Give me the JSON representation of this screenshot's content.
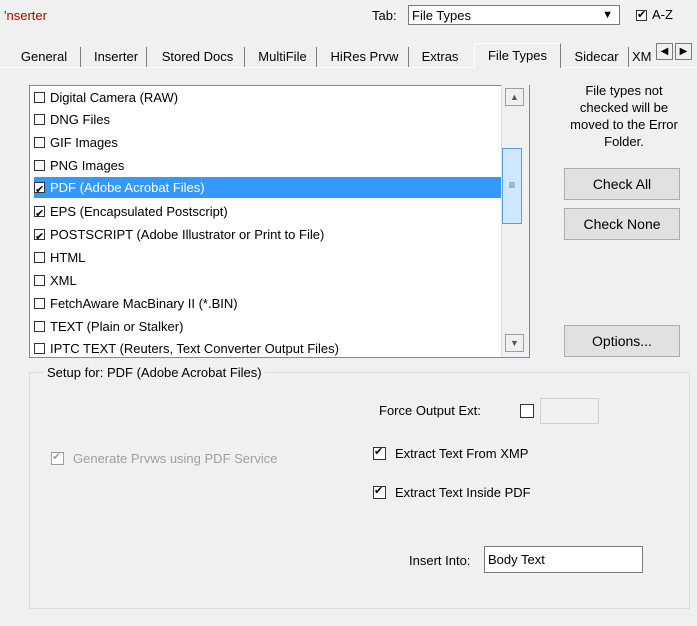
{
  "header": {
    "app_title": "'nserter",
    "tab_label": "Tab:",
    "tab_selected": "File Types",
    "az_label": "A-Z",
    "az_checked": true
  },
  "tabs": [
    {
      "label": "General"
    },
    {
      "label": "Inserter"
    },
    {
      "label": "Stored Docs"
    },
    {
      "label": "MultiFile"
    },
    {
      "label": "HiRes Prvw"
    },
    {
      "label": "Extras"
    },
    {
      "label": "File Types",
      "active": true
    },
    {
      "label": "Sidecar"
    },
    {
      "label": "XM"
    }
  ],
  "file_types": [
    {
      "label": "Digital Camera (RAW)",
      "checked": false
    },
    {
      "label": "DNG Files",
      "checked": false
    },
    {
      "label": "GIF Images",
      "checked": false
    },
    {
      "label": "PNG Images",
      "checked": false
    },
    {
      "label": "PDF (Adobe Acrobat Files)",
      "checked": true,
      "selected": true
    },
    {
      "label": "EPS (Encapsulated Postscript)",
      "checked": true
    },
    {
      "label": "POSTSCRIPT (Adobe Illustrator or Print to File)",
      "checked": true
    },
    {
      "label": "HTML",
      "checked": false
    },
    {
      "label": "XML",
      "checked": false
    },
    {
      "label": "FetchAware MacBinary II (*.BIN)",
      "checked": false
    },
    {
      "label": "TEXT (Plain or Stalker)",
      "checked": false
    },
    {
      "label": "IPTC TEXT (Reuters, Text Converter Output Files)",
      "checked": false
    }
  ],
  "side_note": "File types not checked will be moved to the Error Folder.",
  "buttons": {
    "check_all": "Check All",
    "check_none": "Check None",
    "options": "Options..."
  },
  "setup": {
    "legend": "Setup for:  PDF (Adobe Acrobat Files)",
    "force_output_label": "Force Output Ext:",
    "force_output_checked": false,
    "force_output_value": "",
    "generate_prvws_label": "Generate Prvws using PDF Service",
    "generate_prvws_checked": true,
    "extract_xmp_label": "Extract Text From XMP",
    "extract_xmp_checked": true,
    "extract_pdf_label": "Extract Text Inside PDF",
    "extract_pdf_checked": true,
    "insert_into_label": "Insert Into:",
    "insert_into_value": "Body Text"
  }
}
